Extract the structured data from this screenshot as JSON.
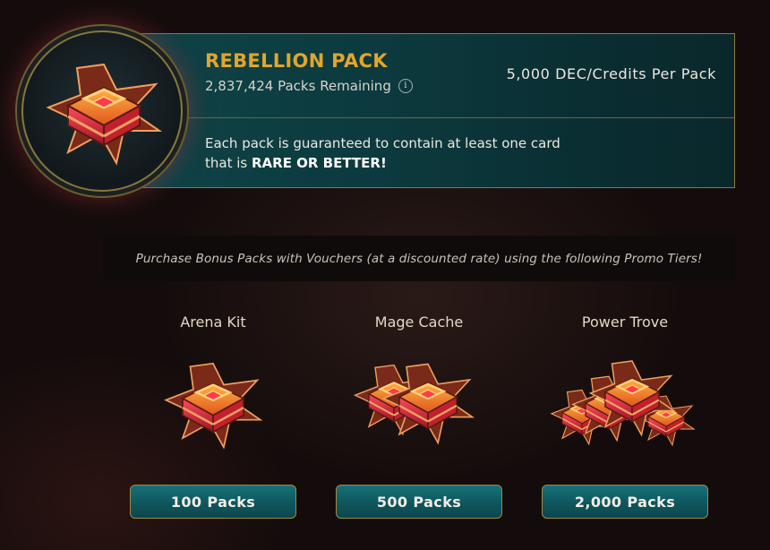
{
  "pack": {
    "title": "REBELLION PACK",
    "remaining": "2,837,424 Packs Remaining",
    "price": "5,000 DEC/Credits Per Pack",
    "guarantee_prefix": "Each pack is guaranteed to contain at least one card that is ",
    "guarantee_bold": "RARE OR BETTER!",
    "info_icon": "info-icon",
    "art_icon": "rebellion-pack-chest"
  },
  "promo": {
    "text": "Purchase Bonus Packs with Vouchers (at a discounted rate) using the following Promo Tiers!"
  },
  "tiers": [
    {
      "name": "Arena Kit",
      "button": "100 Packs",
      "art": "single-chest"
    },
    {
      "name": "Mage Cache",
      "button": "500 Packs",
      "art": "double-chest"
    },
    {
      "name": "Power Trove",
      "button": "2,000 Packs",
      "art": "chest-pile"
    }
  ],
  "colors": {
    "accent_gold": "#e2a52e",
    "banner_teal": "#0f4448",
    "button_teal": "#177179",
    "border_gold": "#9f8a43"
  }
}
